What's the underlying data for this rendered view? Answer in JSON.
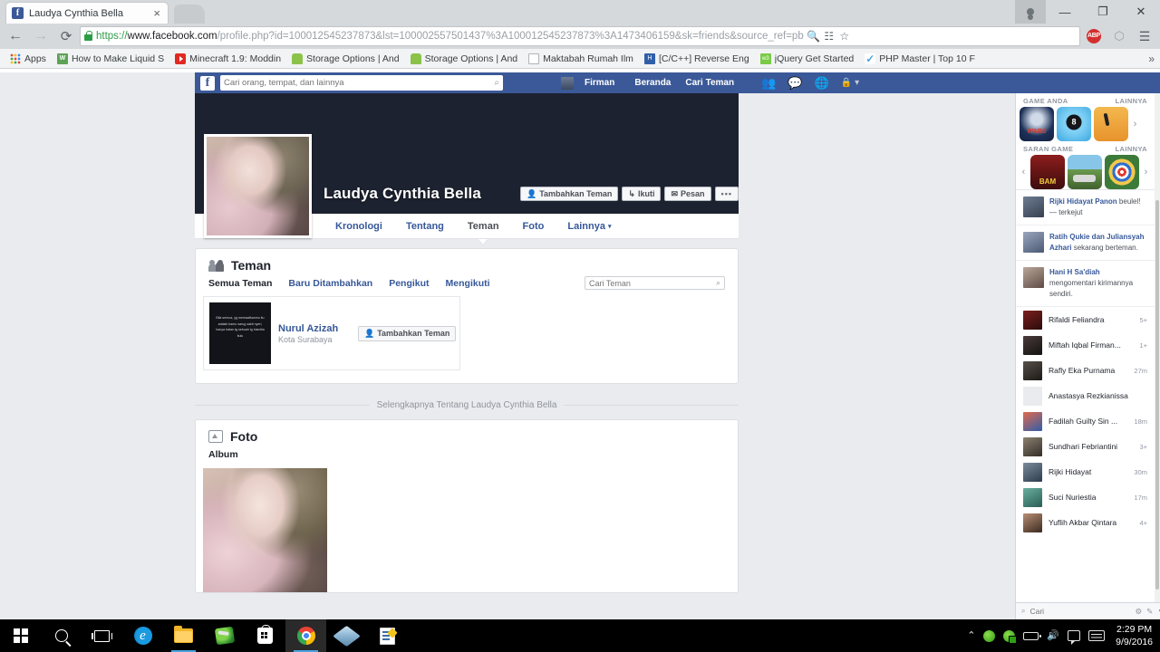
{
  "browser": {
    "tab_title": "Laudya Cynthia Bella",
    "tab_favicon": "f",
    "close_tab_label": "×",
    "back_icon": "←",
    "forward_icon": "→",
    "reload_icon": "⟳",
    "url_scheme": "https://",
    "url_host": "www.facebook.com",
    "url_path": "/profile.php?id=100012545237873&lst=100002557501437%3A100012545237873%3A1473406159&sk=friends&source_ref=pb",
    "zoom_icon": "🔍",
    "translate_icon": "☷",
    "bookmark_star_icon": "☆",
    "ext_abp_label": "ABP",
    "ext_cube_icon": "⬡",
    "menu_icon": "☰",
    "window_minimize": "—",
    "window_restore": "❐",
    "window_close": "✕",
    "bookmarks": [
      {
        "label": "Apps",
        "icon": "apps-grid-icon"
      },
      {
        "label": "How to Make Liquid S",
        "icon": "wikihow-icon"
      },
      {
        "label": "Minecraft 1.9: Moddin",
        "icon": "youtube-icon"
      },
      {
        "label": "Storage Options | And",
        "icon": "android-icon"
      },
      {
        "label": "Storage Options | And",
        "icon": "android-icon"
      },
      {
        "label": "Maktabah Rumah Ilm",
        "icon": "document-icon"
      },
      {
        "label": "[C/C++] Reverse Eng",
        "icon": "cpp-icon"
      },
      {
        "label": "jQuery Get Started",
        "icon": "jquery-icon"
      },
      {
        "label": "PHP Master | Top 10 F",
        "icon": "php-icon"
      }
    ],
    "bookmarks_overflow": "»"
  },
  "facebook": {
    "logo": "f",
    "search_placeholder": "Cari orang, tempat, dan lainnya",
    "search_icon": "⌕",
    "nav": {
      "me": "Firman",
      "home": "Beranda",
      "find_friends": "Cari Teman"
    },
    "icons": {
      "friend_requests": "👥",
      "messages": "💬",
      "notifications": "🌐",
      "privacy": "🔒",
      "privacy_caret": "▾"
    }
  },
  "profile": {
    "name": "Laudya Cynthia Bella",
    "buttons": {
      "add_friend": "Tambahkan Teman",
      "add_friend_icon": "👤",
      "follow": "Ikuti",
      "follow_icon": "↳",
      "message": "Pesan",
      "message_icon": "✉",
      "more": "•••"
    },
    "tabs": [
      {
        "label": "Kronologi",
        "active": false
      },
      {
        "label": "Tentang",
        "active": false
      },
      {
        "label": "Teman",
        "active": true
      },
      {
        "label": "Foto",
        "active": false
      },
      {
        "label": "Lainnya",
        "active": false,
        "caret": "▾"
      }
    ]
  },
  "friends_section": {
    "title": "Teman",
    "subtabs": [
      {
        "label": "Semua Teman",
        "active": true
      },
      {
        "label": "Baru Ditambahkan",
        "active": false
      },
      {
        "label": "Pengikut",
        "active": false
      },
      {
        "label": "Mengikuti",
        "active": false
      }
    ],
    "search_placeholder": "Cari Teman",
    "search_icon": "⌕",
    "friends": [
      {
        "name": "Nurul Azizah",
        "location": "Kota Surabaya",
        "avatar_text": "Bila semua, yg memaafkanmu itu adalah kamu sarug sakit nyeri, hanya hatan tg sebuah tg bismilla itulu",
        "action_label": "Tambahkan Teman",
        "action_icon": "👤"
      }
    ]
  },
  "divider_text": "Selengkapnya Tentang Laudya Cynthia Bella",
  "photos_section": {
    "title": "Foto",
    "album_label": "Album"
  },
  "rail": {
    "games_section": {
      "title": "GAME ANDA",
      "more": "LAINNYA"
    },
    "suggested_section": {
      "title": "SARAN GAME",
      "more": "LAINNYA"
    },
    "arrow_right": "›",
    "arrow_left": "‹",
    "ticker": [
      {
        "name": "Rijki Hidayat Panon",
        "text": "beulel! — terkejut"
      },
      {
        "name": "Ratih Qukie dan Juliansyah Azhari",
        "text": "sekarang berteman."
      },
      {
        "name": "Hani H Sa'diah",
        "text": "mengomentari kirimannya sendiri."
      }
    ],
    "chat": [
      {
        "name": "Rifaldi Feliandra",
        "badge": "5+"
      },
      {
        "name": "Miftah Iqbal Firman...",
        "badge": "1+"
      },
      {
        "name": "Rafly Eka Purnama",
        "badge": "27m"
      },
      {
        "name": "Anastasya Rezkianissa",
        "badge": ""
      },
      {
        "name": "Fadilah Guilty Sin ...",
        "badge": "18m"
      },
      {
        "name": "Sundhari Febriantini",
        "badge": "3+"
      },
      {
        "name": "Rijki Hidayat",
        "badge": "30m"
      },
      {
        "name": "Suci Nuriestia",
        "badge": "17m"
      },
      {
        "name": "Yuflih Akbar Qintara",
        "badge": "4+"
      }
    ],
    "chatbar": {
      "search_placeholder": "Cari",
      "search_icon": "⌕",
      "gear_icon": "⚙",
      "compose_icon": "✎",
      "collapse_icon": "▼"
    }
  },
  "taskbar": {
    "items": [
      {
        "name": "start-button"
      },
      {
        "name": "search-button"
      },
      {
        "name": "task-view-button"
      },
      {
        "name": "edge-button"
      },
      {
        "name": "file-explorer-button"
      },
      {
        "name": "idm-button"
      },
      {
        "name": "store-button"
      },
      {
        "name": "chrome-button"
      },
      {
        "name": "virtualbox-button"
      },
      {
        "name": "notepad-button"
      }
    ],
    "tray": {
      "expand_icon": "⌃",
      "time": "2:29 PM",
      "date": "9/9/2016"
    }
  }
}
